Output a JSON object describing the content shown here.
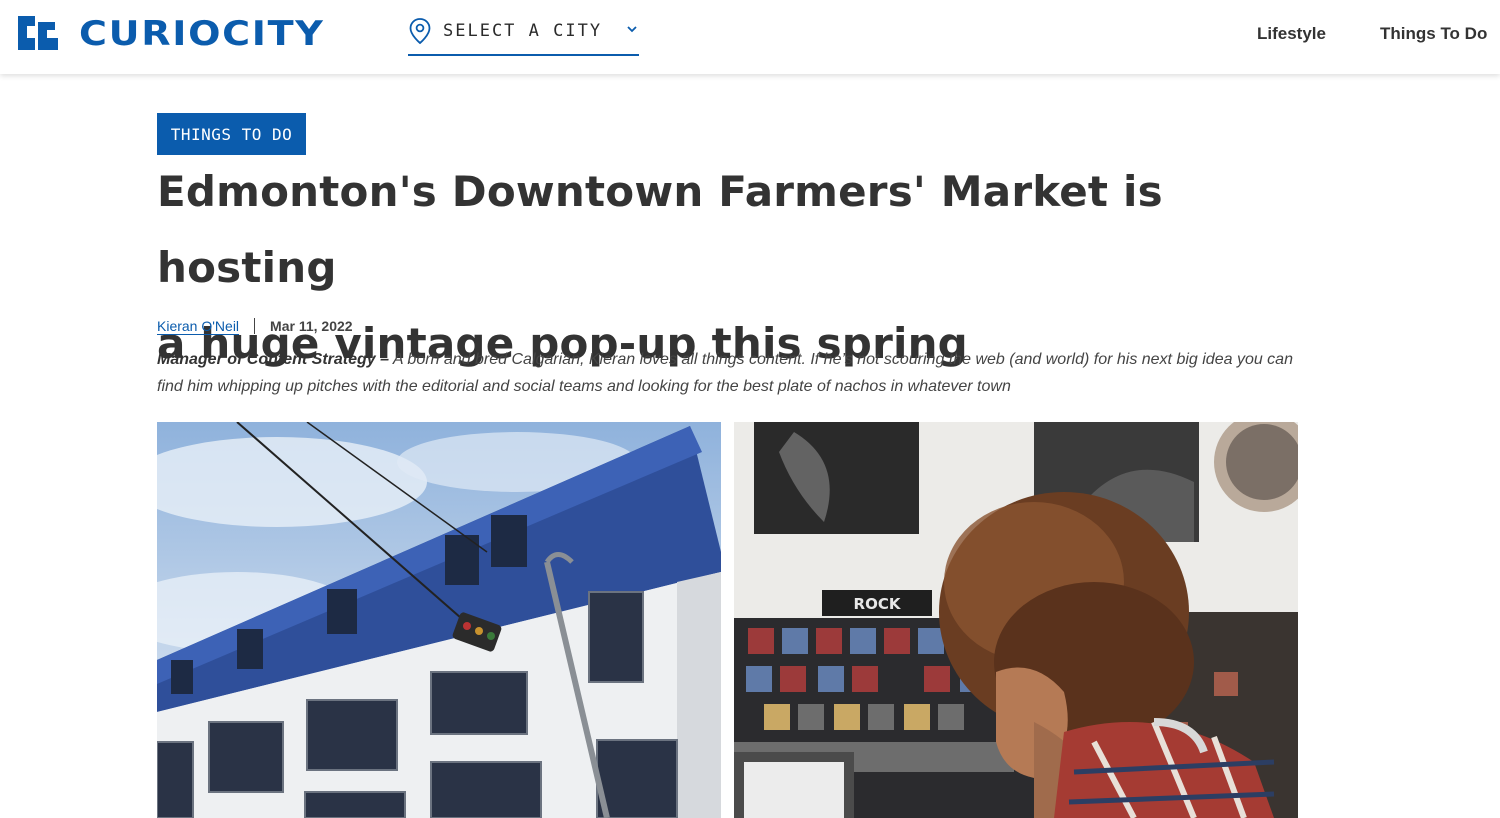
{
  "header": {
    "logo_text": "CURIOCITY",
    "city_select_label": "SELECT A CITY",
    "nav": [
      "Lifestyle",
      "Things To Do"
    ]
  },
  "article": {
    "category": "THINGS TO DO",
    "title_line1": "Edmonton's Downtown Farmers' Market is hosting",
    "title_line2": "a huge vintage pop-up this spring",
    "author": "Kieran O'Neil",
    "date": "Mar 11, 2022",
    "author_role": "Manager of Content Strategy –",
    "author_bio": "A born and bred Calgarian, Kieran loves all things content. If he’s not scouring the web (and world) for his next big idea you can find him whipping up pitches with the editorial and social teams and looking for the best plate of nachos in whatever town",
    "images": [
      {
        "icon": "building-photo"
      },
      {
        "icon": "record-store-photo",
        "sign_text": "ROCK"
      }
    ]
  },
  "colors": {
    "brand": "#0b5cad",
    "text": "#333333",
    "background": "#ffffff"
  }
}
